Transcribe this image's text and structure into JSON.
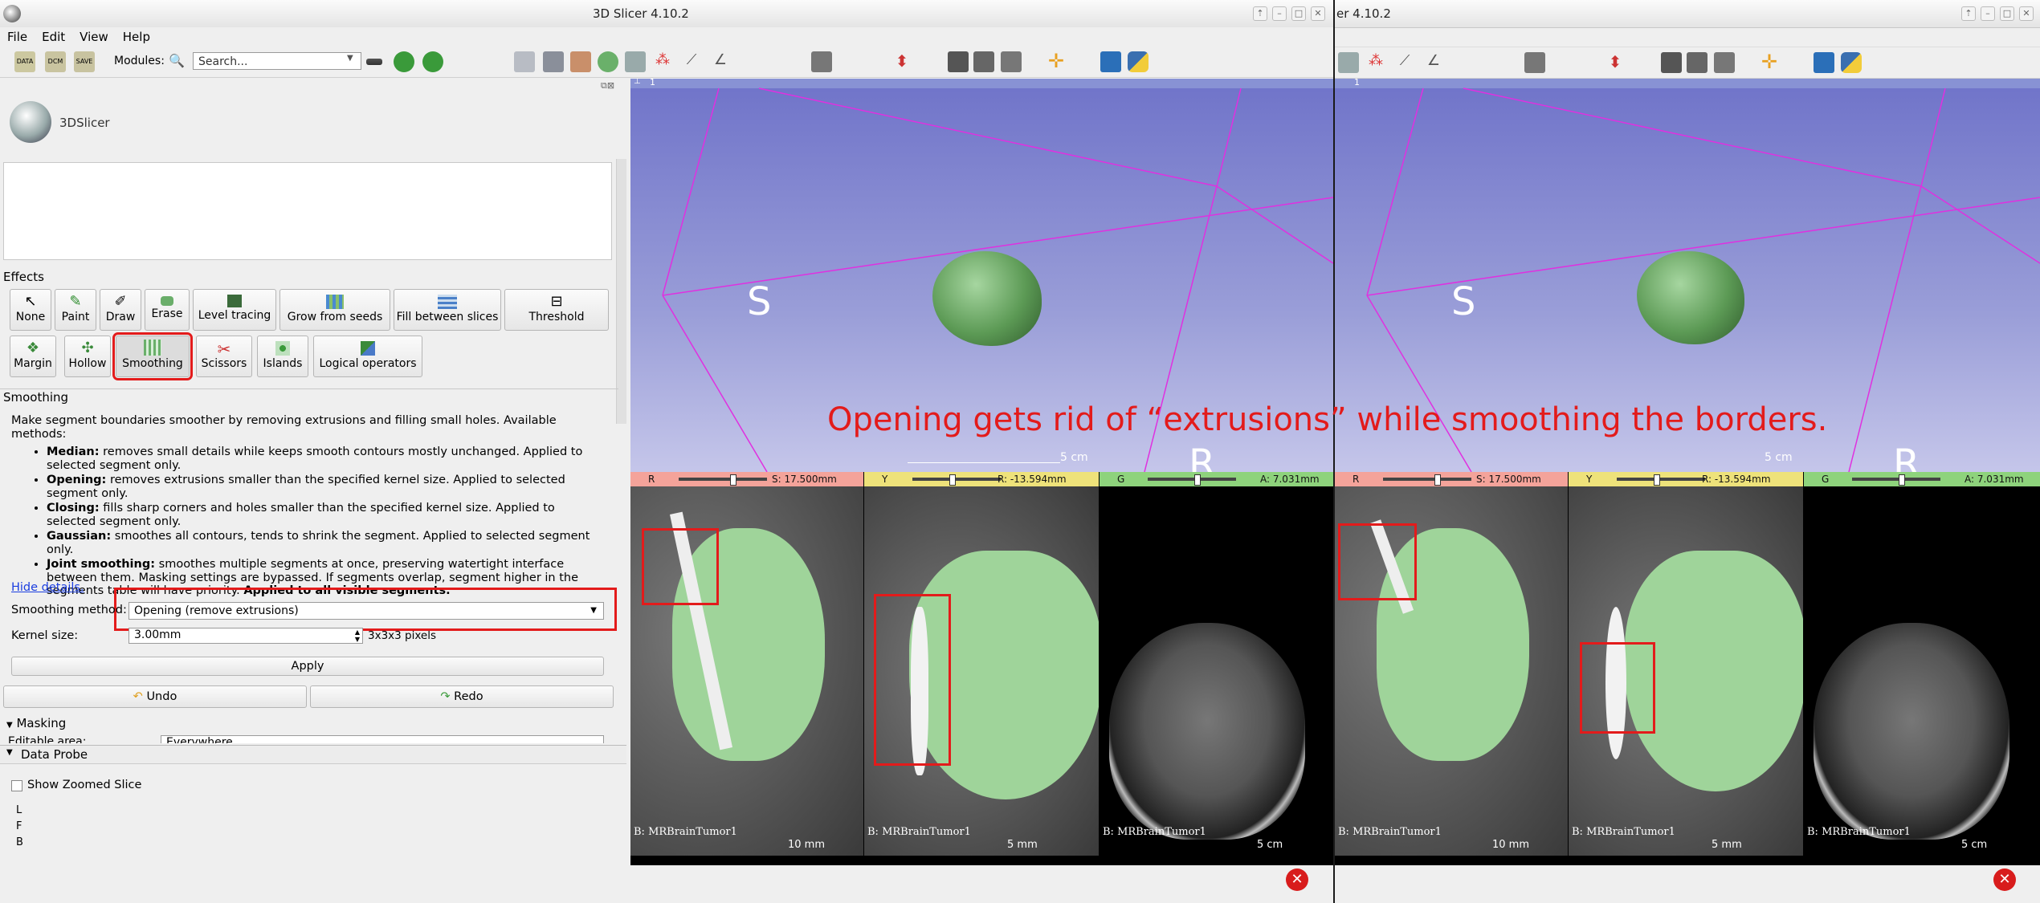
{
  "window_left": {
    "title": "3D Slicer 4.10.2",
    "menu": [
      "File",
      "Edit",
      "View",
      "Help"
    ]
  },
  "window_right": {
    "title": "er 4.10.2"
  },
  "toolbar": {
    "icons_left": [
      "DATA",
      "DCM",
      "SAVE"
    ],
    "modules_label": "Modules:",
    "search_placeholder": "Search..."
  },
  "logo": {
    "text": "3DSlicer"
  },
  "effects": {
    "header": "Effects",
    "row1": [
      "None",
      "Paint",
      "Draw",
      "Erase",
      "Level tracing",
      "Grow from seeds",
      "Fill between slices",
      "Threshold"
    ],
    "row2": [
      "Margin",
      "Hollow",
      "Smoothing",
      "Scissors",
      "Islands",
      "Logical operators"
    ],
    "selected": "Smoothing"
  },
  "smoothing": {
    "section_title": "Smoothing",
    "intro": "Make segment boundaries smoother by removing extrusions and filling small holes. Available methods:",
    "methods": [
      {
        "name": "Median:",
        "text": " removes small details while keeps smooth contours mostly unchanged. Applied to selected segment only."
      },
      {
        "name": "Opening:",
        "text": " removes extrusions smaller than the specified kernel size. Applied to selected segment only."
      },
      {
        "name": "Closing:",
        "text": " fills sharp corners and holes smaller than the specified kernel size. Applied to selected segment only."
      },
      {
        "name": "Gaussian:",
        "text": " smoothes all contours, tends to shrink the segment. Applied to selected segment only."
      },
      {
        "name": "Joint smoothing:",
        "text": " smoothes multiple segments at once, preserving watertight interface between them. Masking settings are bypassed. If segments overlap, segment higher in the segments table will have priority. ",
        "bold_tail": "Applied to all visible segments."
      }
    ],
    "hide_details": "Hide details.",
    "method_label": "Smoothing method:",
    "method_value": "Opening (remove extrusions)",
    "kernel_label": "Kernel size:",
    "kernel_value": "3.00mm",
    "kernel_pixels": "3x3x3 pixels",
    "apply": "Apply",
    "undo": "Undo",
    "redo": "Redo",
    "masking": "Masking",
    "editable_area_label": "Editable area:",
    "editable_area_value": "Everywhere"
  },
  "data_probe": {
    "header": "Data Probe",
    "show_zoomed": "Show Zoomed Slice",
    "coords": [
      "L",
      "F",
      "B"
    ]
  },
  "view3d": {
    "layout_number": "1",
    "orientation_S": "S",
    "orientation_R": "R",
    "scale": "5 cm"
  },
  "slices": [
    {
      "color": "R",
      "offset": "S: 17.500mm",
      "bar_color": "#f4a39a",
      "label": "B: MRBrainTumor1",
      "scale": "10 mm"
    },
    {
      "color": "Y",
      "offset": "R: -13.594mm",
      "bar_color": "#eee27a",
      "label": "B: MRBrainTumor1",
      "scale": "5 mm"
    },
    {
      "color": "G",
      "offset": "A: 7.031mm",
      "bar_color": "#8ed37c",
      "label": "B: MRBrainTumor1",
      "scale": "5 cm"
    }
  ],
  "annotation": "Opening gets rid of “extrusions” while smoothing the borders.",
  "colors": {
    "highlight": "#e31b1b",
    "segment": "#9fd49a"
  }
}
